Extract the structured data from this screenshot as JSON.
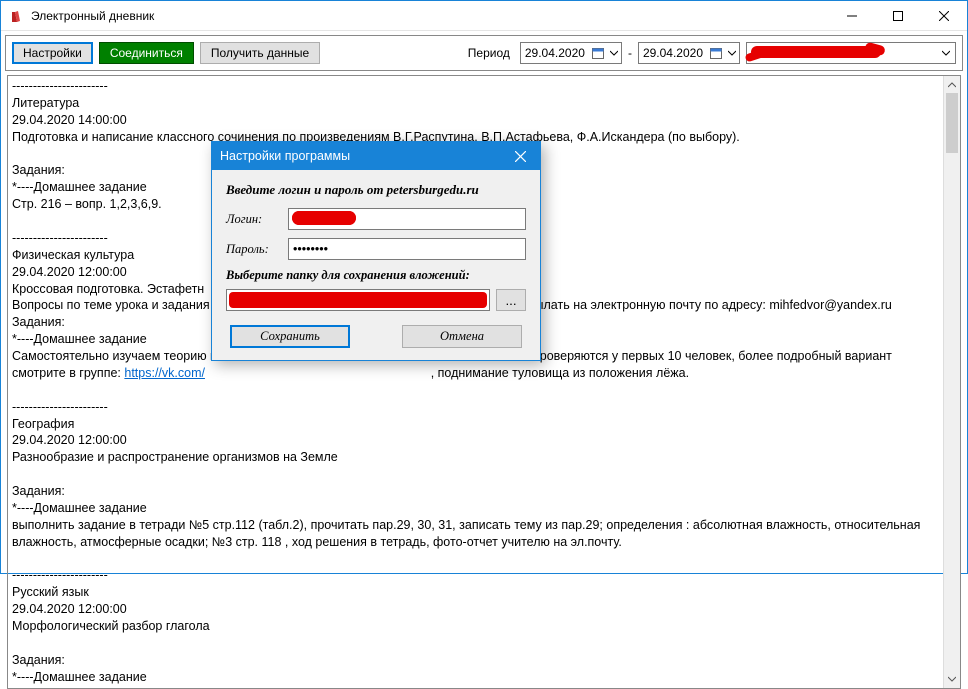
{
  "window": {
    "title": "Электронный дневник"
  },
  "toolbar": {
    "settings": "Настройки",
    "connect": "Соединиться",
    "get_data": "Получить данные",
    "period_label": "Период",
    "date_from": "29.04.2020",
    "date_to": "29.04.2020",
    "dash": "-"
  },
  "content": {
    "sep": "-----------------------",
    "lit_subj": "Литература",
    "lit_time": "29.04.2020 14:00:00",
    "lit_desc": "Подготовка и написание классного сочинения по произведениям В.Г.Распутина, В.П.Астафьева, Ф.А.Искандера (по выбору).",
    "tasks": "Задания:",
    "hw": "*----Домашнее задание",
    "lit_hw": "Стр. 216 – вопр. 1,2,3,6,9.",
    "pe_subj": "Физическая культура",
    "pe_time": "29.04.2020 12:00:00",
    "pe_l1": "Кроссовая подготовка. Эстафетн",
    "pe_l2a": "Вопросы по теме урока и задания",
    "pe_l2b": "нные работы присылать на электронную почту по адресу: mihfedvor@yandex.ru",
    "pe_l3a": "Самостоятельно изучаем теорию и",
    "pe_l3b": "Тегкой атлетике\" проверяются у первых 10 человек, более подробный вариант",
    "pe_l4a": "смотрите в группе: ",
    "pe_link": "https://vk.com/",
    "pe_l4b": ", поднимание туловища из положения лёжа.",
    "geo_subj": "География",
    "geo_time": "29.04.2020 12:00:00",
    "geo_desc": "Разнообразие и распространение организмов на Земле",
    "geo_hw": "выполнить задание в тетради №5 стр.112 (табл.2), прочитать пар.29, 30, 31, записать тему из пар.29; определения : абсолютная влажность, относительная влажность, атмосферные осадки; №3 стр. 118 , ход решения в тетрадь, фото-отчет учителю на эл.почту.",
    "rus_subj": "Русский язык",
    "rus_time": "29.04.2020 12:00:00",
    "rus_desc": "Морфологический разбор глагола"
  },
  "modal": {
    "title": "Настройки программы",
    "header": "Введите логин и пароль от petersburgedu.ru",
    "login_label": "Логин:",
    "password_label": "Пароль:",
    "password_value": "********",
    "folder_header": "Выберите папку для сохранения вложений:",
    "browse": "...",
    "save": "Сохранить",
    "cancel": "Отмена"
  }
}
